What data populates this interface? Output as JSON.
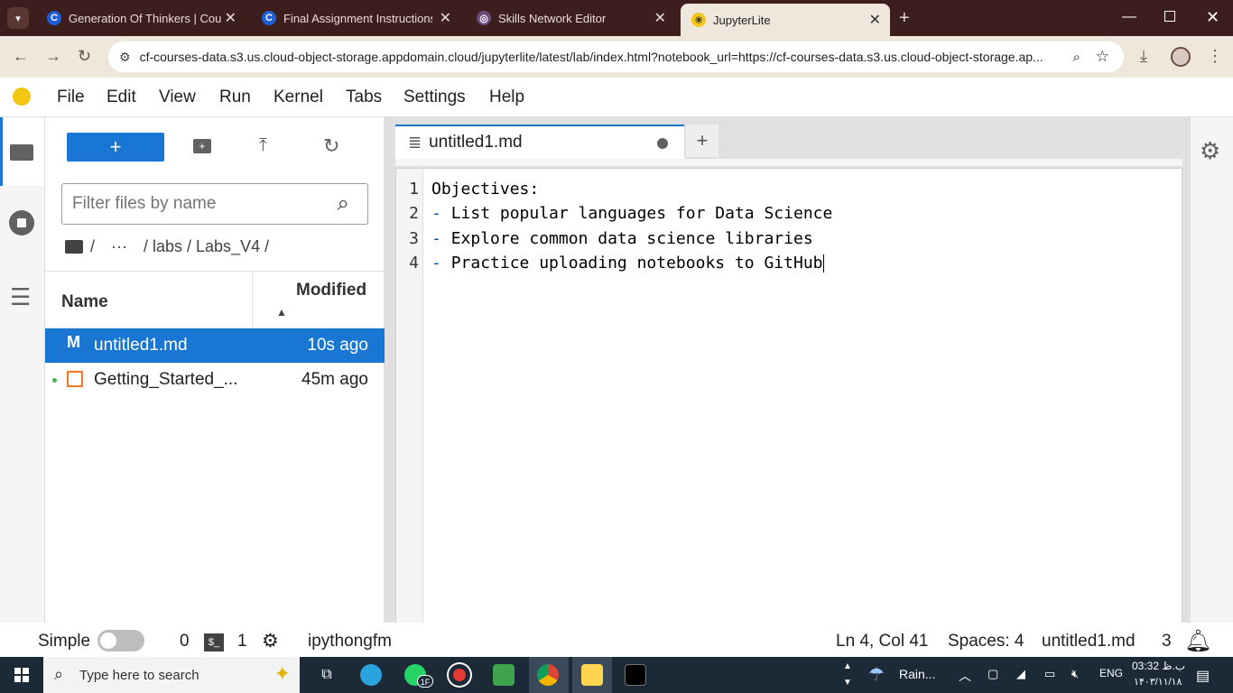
{
  "browser": {
    "tabs": [
      {
        "title": "Generation Of Thinkers | Course"
      },
      {
        "title": "Final Assignment Instructions: C"
      },
      {
        "title": "Skills Network Editor"
      },
      {
        "title": "JupyterLite"
      }
    ],
    "url": "cf-courses-data.s3.us.cloud-object-storage.appdomain.cloud/jupyterlite/latest/lab/index.html?notebook_url=https://cf-courses-data.s3.us.cloud-object-storage.ap..."
  },
  "menu": [
    "File",
    "Edit",
    "View",
    "Run",
    "Kernel",
    "Tabs",
    "Settings",
    "Help"
  ],
  "filebrowser": {
    "new_label": "+",
    "filter_placeholder": "Filter files by name",
    "breadcrumb": [
      "/",
      "···",
      "/ labs / Labs_V4 /"
    ],
    "col_name": "Name",
    "col_modified": "Modified",
    "files": [
      {
        "name": "untitled1.md",
        "modified": "10s ago"
      },
      {
        "name": "Getting_Started_...",
        "modified": "45m ago"
      }
    ]
  },
  "editor": {
    "tab_title": "untitled1.md",
    "add_tab": "+",
    "lines": [
      {
        "num": "1",
        "text": "Objectives:"
      },
      {
        "num": "2",
        "bullet": "- ",
        "text": "List popular languages for Data Science"
      },
      {
        "num": "3",
        "bullet": "- ",
        "text": "Explore common data science libraries"
      },
      {
        "num": "4",
        "bullet": "- ",
        "text": "Practice uploading notebooks to GitHub"
      }
    ]
  },
  "status": {
    "mode": "Simple",
    "kernels": "0",
    "terminals": "1",
    "extension": "ipythongfm",
    "position": "Ln 4, Col 41",
    "spaces": "Spaces: 4",
    "filename": "untitled1.md",
    "notifications": "3"
  },
  "taskbar": {
    "search": "Type here to search",
    "weather": "Rain...",
    "lang": "ENG",
    "time": "03:32 ب.ظ",
    "date": "۱۴۰۳/۱۱/۱۸",
    "badge": "1F"
  },
  "colors": {
    "accent": "#1976d2",
    "chrome_dark": "#3c1f1d",
    "chrome_light": "#efe6dc"
  }
}
